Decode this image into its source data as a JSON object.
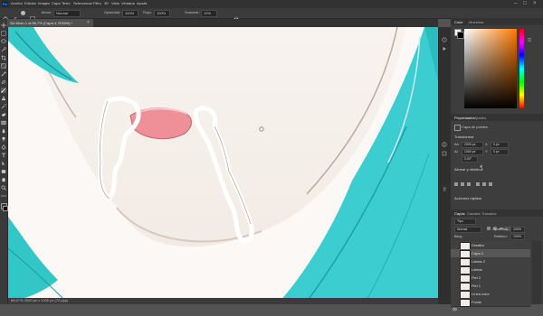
{
  "app": {
    "logo": "Ps",
    "menu": [
      "Archivo",
      "Edición",
      "Imagen",
      "Capa",
      "Texto",
      "Seleccionar",
      "Filtro",
      "3D",
      "Vista",
      "Ventana",
      "Ayuda"
    ]
  },
  "options": {
    "mode_label": "Modo:",
    "mode_value": "Normal",
    "opacity_label": "Opacidad:",
    "opacity_value": "100%",
    "flow_label": "Flujo:",
    "flow_value": "100%",
    "smooth_label": "Suavizar:",
    "smooth_value": "10%"
  },
  "document": {
    "tab_title": "Sin título-1 al 66,7% (Capa 4, RGB/8) *",
    "status": "66,67%   2000 px x 1000 px (72 ppp)"
  },
  "panels": {
    "color_tabs": [
      "Color",
      "Muestras"
    ],
    "colors": {
      "fg": "#ffffff",
      "bg": "#000000",
      "picker_hue": "#ff7a00"
    },
    "properties_tabs": [
      "Propiedades",
      "Ajustes"
    ],
    "properties": {
      "layer_type": "Capa de píxeles",
      "transform_title": "Transformar",
      "w_label": "An",
      "w_value": "2000 px",
      "h_label": "Al",
      "h_value": "1000 px",
      "x_label": "X",
      "x_value": "0 px",
      "y_label": "Y",
      "y_value": "0 px",
      "angle_value": "0,00°",
      "align_title": "Alinear y distribuir",
      "quick_title": "Acciones rápidas"
    },
    "layers_tabs": [
      "Capas",
      "Canales",
      "Trazados"
    ],
    "layers_controls": {
      "filter_label": "Tipo",
      "blend": "Normal",
      "opacity_label": "Opacidad:",
      "opacity_value": "100%",
      "lock_label": "Bloq.:",
      "fill_label": "Relleno:",
      "fill_value": "100%"
    },
    "layers": [
      {
        "name": "Detalles"
      },
      {
        "name": "Capa 4"
      },
      {
        "name": "Labios 2"
      },
      {
        "name": "Labios"
      },
      {
        "name": "Piel 2"
      },
      {
        "name": "Piel 1"
      },
      {
        "name": "Línea color"
      },
      {
        "name": "Fondo"
      }
    ]
  }
}
